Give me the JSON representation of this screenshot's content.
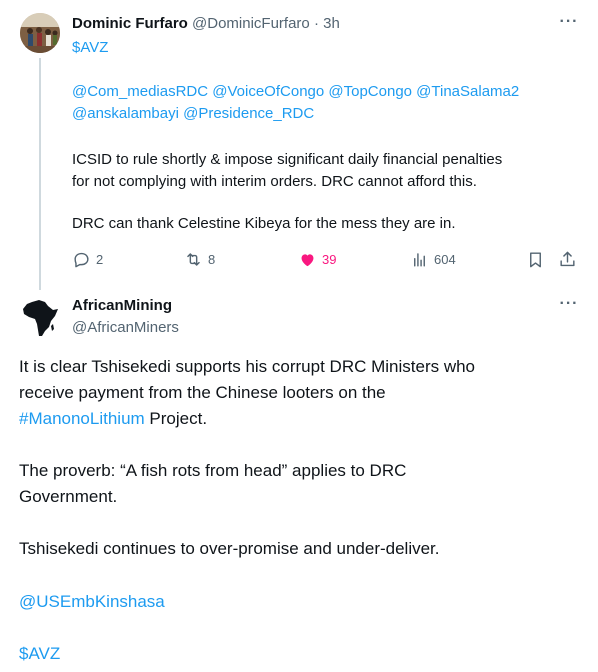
{
  "tweet1": {
    "display_name": "Dominic Furfaro",
    "handle": "@DominicFurfaro",
    "separator": "·",
    "time": "3h",
    "cashtag": "$AVZ",
    "mentions_line1": "@Com_mediasRDC @VoiceOfCongo @TopCongo @TinaSalama2",
    "mentions_line2": "@anskalambayi @Presidence_RDC",
    "text_line1": "ICSID to rule shortly & impose significant daily financial penalties",
    "text_line2": "for not complying with interim orders. DRC cannot afford this.",
    "text_line3": "DRC can thank Celestine Kibeya for the mess they are in.",
    "replies": "2",
    "retweets": "8",
    "likes": "39",
    "views": "604",
    "more_label": "···"
  },
  "tweet2": {
    "display_name": "AfricanMining",
    "handle": "@AfricanMiners",
    "more_label": "···",
    "para1_line1": "It is clear Tshisekedi supports his corrupt DRC Ministers who",
    "para1_line2": "receive payment from the Chinese looters on the",
    "hashtag": "#ManonoLithium",
    "para1_line3_rest": " Project.",
    "para2_line1": "The proverb: “A fish rots from head” applies to DRC",
    "para2_line2": "Government.",
    "para3": "Tshisekedi continues to over-promise and under-deliver.",
    "mention": "@USEmbKinshasa",
    "cashtag": "$AVZ"
  },
  "colors": {
    "link": "#1d9bf0",
    "muted": "#536471",
    "like": "#f91880",
    "thread_line": "#cfd9de"
  },
  "icons": [
    "reply-icon",
    "retweet-icon",
    "heart-icon",
    "views-icon",
    "bookmark-icon",
    "share-icon",
    "more-icon",
    "africa-map-icon"
  ]
}
